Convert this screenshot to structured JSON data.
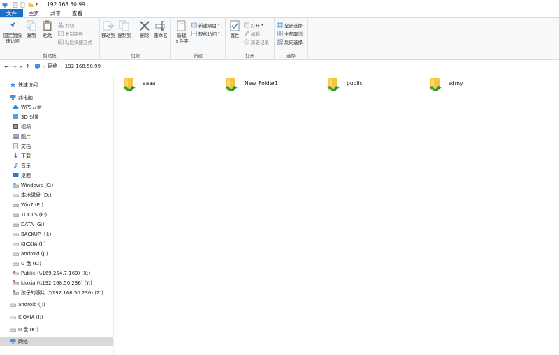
{
  "title": "192.168.50.99",
  "tabs": [
    "文件",
    "主页",
    "共享",
    "查看"
  ],
  "ribbon": {
    "clipboard": {
      "label": "剪贴板",
      "pin": "固定到快\n速访问",
      "copy": "复制",
      "paste": "粘贴",
      "cut": "剪切",
      "copy_path": "复制路径",
      "paste_shortcut": "粘贴快捷方式"
    },
    "organize": {
      "label": "组织",
      "move_to": "移动到",
      "copy_to": "复制到",
      "delete": "删除",
      "rename": "重命名"
    },
    "new": {
      "label": "新建",
      "new_folder": "新建\n文件夹",
      "new_item": "新建项目",
      "easy_access": "轻松访问"
    },
    "open": {
      "label": "打开",
      "properties": "属性",
      "open": "打开",
      "edit": "编辑",
      "history": "历史记录"
    },
    "select": {
      "label": "选择",
      "select_all": "全部选择",
      "select_none": "全部取消",
      "invert": "反向选择"
    }
  },
  "address": {
    "root": "网络",
    "current": "192.168.50.99"
  },
  "nav": {
    "quick_access": "快速访问",
    "this_pc": "此电脑",
    "items": [
      "WPS云盘",
      "3D 对象",
      "视频",
      "图片",
      "文档",
      "下载",
      "音乐",
      "桌面",
      "Windows (C:)",
      "本地磁盘 (D:)",
      "Win7 (E:)",
      "TOOLS (F:)",
      "DATA (G:)",
      "BACKUP (H:)",
      "KIOXIA (I:)",
      "android (J:)",
      "U 盘 (K:)",
      "Public (\\\\169.254.7.169) (X:)",
      "kioxia (\\\\192.168.50.236) (Y:)",
      "孩子的照片 (\\\\192.168.50.236) (Z:)"
    ],
    "drives_top": [
      "android (J:)",
      "KIOXIA (I:)",
      "U 盘 (K:)"
    ],
    "network": "网络"
  },
  "folders": [
    "aaaa",
    "New_Folder1",
    "public",
    "sdmy"
  ],
  "colors": {
    "accent": "#1a6fc9",
    "folder": "#f4c542",
    "share": "#3aa03a",
    "selected": "#d9d9d9"
  }
}
